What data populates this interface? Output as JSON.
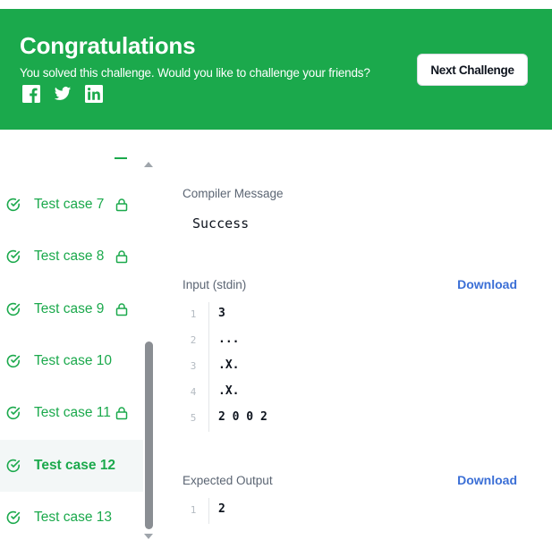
{
  "banner": {
    "title": "Congratulations",
    "subtitle": "You solved this challenge. Would you like to challenge your friends?",
    "next_button": "Next Challenge",
    "social_icons": [
      "facebook-icon",
      "twitter-icon",
      "linkedin-icon"
    ],
    "background_color": "#1ba94c"
  },
  "test_cases": [
    {
      "label": "Test case 7",
      "passed": true,
      "locked": true,
      "active": false
    },
    {
      "label": "Test case 8",
      "passed": true,
      "locked": true,
      "active": false
    },
    {
      "label": "Test case 9",
      "passed": true,
      "locked": true,
      "active": false
    },
    {
      "label": "Test case 10",
      "passed": true,
      "locked": false,
      "active": false
    },
    {
      "label": "Test case 11",
      "passed": true,
      "locked": true,
      "active": false
    },
    {
      "label": "Test case 12",
      "passed": true,
      "locked": false,
      "active": true
    },
    {
      "label": "Test case 13",
      "passed": true,
      "locked": false,
      "active": false
    }
  ],
  "compiler": {
    "label": "Compiler Message",
    "message": "Success"
  },
  "input": {
    "label": "Input (stdin)",
    "download": "Download",
    "lines": [
      {
        "n": "1",
        "text": "3"
      },
      {
        "n": "2",
        "text": "..."
      },
      {
        "n": "3",
        "text": ".X."
      },
      {
        "n": "4",
        "text": ".X."
      },
      {
        "n": "5",
        "text": "2 0 0 2"
      }
    ]
  },
  "expected": {
    "label": "Expected Output",
    "download": "Download",
    "lines": [
      {
        "n": "1",
        "text": "2"
      }
    ]
  },
  "colors": {
    "success_green": "#1ba94c",
    "link_blue": "#3b6fd6"
  }
}
